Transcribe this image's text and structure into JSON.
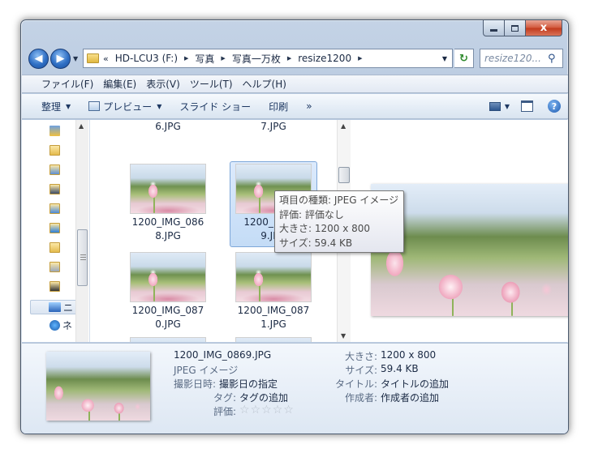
{
  "window": {
    "caption_close": "x"
  },
  "address": {
    "overflow": "«",
    "crumbs": [
      "HD-LCU3 (F:)",
      "写真",
      "写真一万枚",
      "resize1200"
    ],
    "search_placeholder": "resize120..."
  },
  "menu": [
    "ファイル(F)",
    "編集(E)",
    "表示(V)",
    "ツール(T)",
    "ヘルプ(H)"
  ],
  "toolbar": {
    "organize": "整理",
    "preview": "プレビュー",
    "slideshow": "スライド ショー",
    "print": "印刷",
    "more": "»"
  },
  "sidebar": {
    "labels": [
      "ニ",
      "ネ"
    ]
  },
  "files": [
    {
      "line1": "",
      "line2": "6.JPG"
    },
    {
      "line1": "",
      "line2": "7.JPG"
    },
    {
      "line1": "1200_IMG_086",
      "line2": "8.JPG"
    },
    {
      "line1": "1200_IMG_0",
      "line2": "9.JPG"
    },
    {
      "line1": "1200_IMG_087",
      "line2": "0.JPG"
    },
    {
      "line1": "1200_IMG_087",
      "line2": "1.JPG"
    }
  ],
  "tooltip": {
    "type": "項目の種類: JPEG イメージ",
    "rating": "評価: 評価なし",
    "dimensions": "大きさ: 1200 x 800",
    "size": "サイズ: 59.4 KB"
  },
  "details": {
    "filename": "1200_IMG_0869.JPG",
    "filetype": "JPEG イメージ",
    "date_label": "撮影日時:",
    "date_value": "撮影日の指定",
    "tags_label": "タグ:",
    "tags_value": "タグの追加",
    "rating_label": "評価:",
    "rating_stars": 0,
    "dim_label": "大きさ:",
    "dim_value": "1200 x 800",
    "size_label": "サイズ:",
    "size_value": "59.4 KB",
    "title_label": "タイトル:",
    "title_value": "タイトルの追加",
    "author_label": "作成者:",
    "author_value": "作成者の追加"
  },
  "colors": {
    "selection": "#c4dcf6",
    "tulip_pink": "#f4b6c8",
    "sky": "#dbe8f6"
  }
}
